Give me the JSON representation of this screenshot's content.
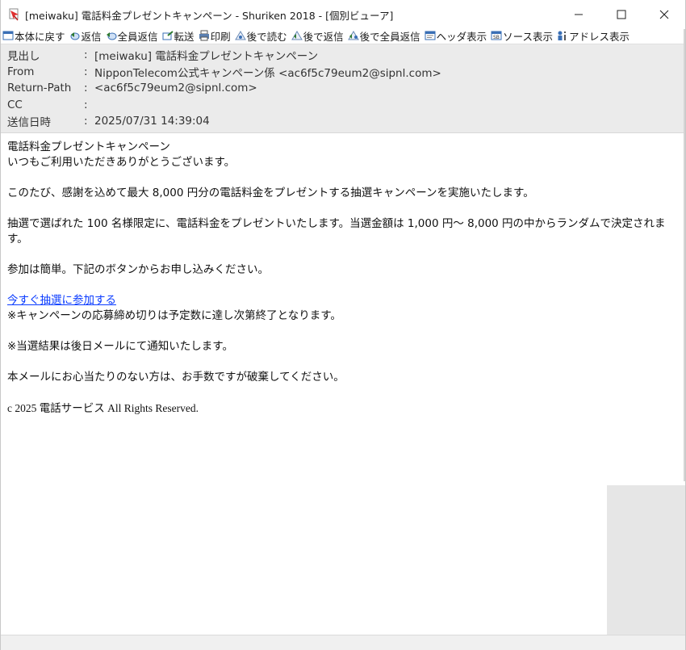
{
  "window": {
    "title": "[meiwaku] 電話料金プレゼントキャンペーン - Shuriken 2018 - [個別ビューア]"
  },
  "toolbar": {
    "items": [
      {
        "label": "本体に戻す",
        "icon": "return-to-main-icon"
      },
      {
        "label": "返信",
        "icon": "reply-icon"
      },
      {
        "label": "全員返信",
        "icon": "reply-all-icon"
      },
      {
        "label": "転送",
        "icon": "forward-icon"
      },
      {
        "label": "印刷",
        "icon": "print-icon"
      },
      {
        "label": "後で読む",
        "icon": "read-later-icon"
      },
      {
        "label": "後で返信",
        "icon": "reply-later-icon"
      },
      {
        "label": "後で全員返信",
        "icon": "reply-all-later-icon"
      },
      {
        "label": "ヘッダ表示",
        "icon": "header-view-icon"
      },
      {
        "label": "ソース表示",
        "icon": "source-view-icon"
      },
      {
        "label": "アドレス表示",
        "icon": "address-view-icon"
      }
    ]
  },
  "headers": {
    "separator": ":",
    "rows": [
      {
        "label": "見出し",
        "value": "[meiwaku] 電話料金プレゼントキャンペーン"
      },
      {
        "label": "From",
        "value": "NipponTelecom公式キャンペーン係 <ac6f5c79eum2@sipnl.com>"
      },
      {
        "label": "Return-Path",
        "value": "<ac6f5c79eum2@sipnl.com>"
      },
      {
        "label": "CC",
        "value": ""
      },
      {
        "label": "送信日時",
        "value": "2025/07/31 14:39:04"
      }
    ]
  },
  "body": {
    "line1": "電話料金プレゼントキャンペーン",
    "line2": "いつもご利用いただきありがとうございます。",
    "para1": "このたび、感謝を込めて最大 8,000 円分の電話料金をプレゼントする抽選キャンペーンを実施いたします。",
    "para2": "抽選で選ばれた 100 名様限定に、電話料金をプレゼントいたします。当選金額は 1,000 円〜 8,000 円の中からランダムで決定されます。",
    "para3": "参加は簡単。下記のボタンからお申し込みください。",
    "link": "今すぐ抽選に参加する",
    "note1": "※キャンペーンの応募締め切りは予定数に達し次第終了となります。",
    "note2": "※当選結果は後日メールにて通知いたします。",
    "para4": "本メールにお心当たりのない方は、お手数ですが破棄してください。",
    "copyright": "c 2025 電話サービス All Rights Reserved."
  }
}
